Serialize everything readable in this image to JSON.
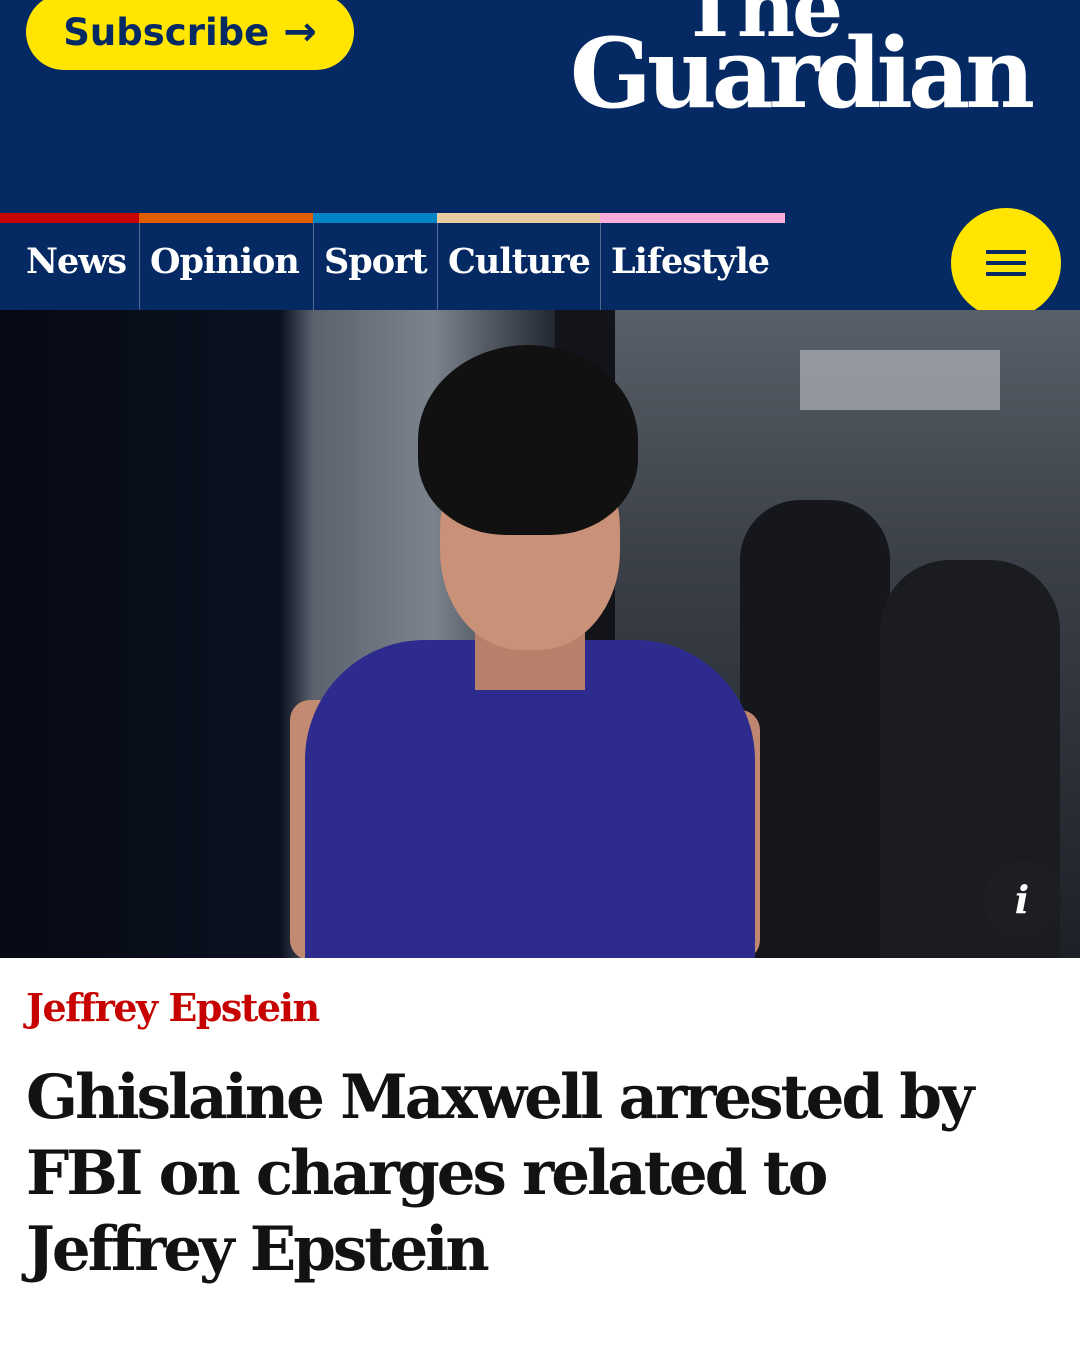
{
  "header": {
    "subscribe_label": "Subscribe",
    "subscribe_icon": "arrow-right-icon",
    "logo_line1": "The",
    "logo_line2": "Guardian"
  },
  "nav": {
    "items": [
      {
        "label": "News",
        "color": "#c70000"
      },
      {
        "label": "Opinion",
        "color": "#e05e00"
      },
      {
        "label": "Sport",
        "color": "#0084c6"
      },
      {
        "label": "Culture",
        "color": "#eacca0"
      },
      {
        "label": "Lifestyle",
        "color": "#ffabdb"
      }
    ],
    "menu_icon": "hamburger-icon"
  },
  "hero": {
    "info_label": "i"
  },
  "article": {
    "kicker": "Jeffrey Epstein",
    "headline": "Ghislaine Maxwell arrested by FBI on charges related to Jeffrey Epstein"
  },
  "colors": {
    "brand_blue": "#052962",
    "accent_yellow": "#ffe500",
    "kicker_red": "#c70000"
  }
}
